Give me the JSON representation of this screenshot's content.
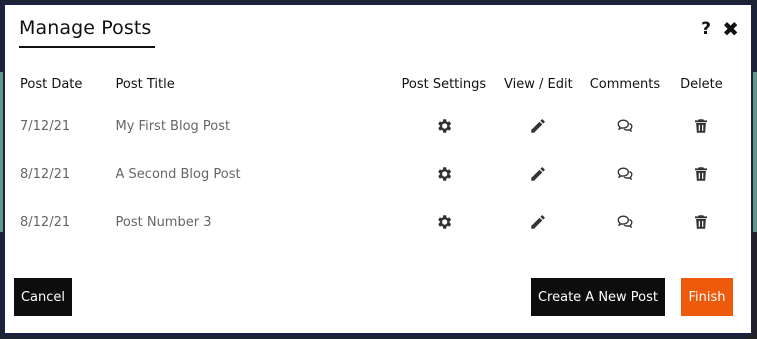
{
  "modal": {
    "title": "Manage Posts",
    "help_glyph": "?",
    "close_glyph": "✖"
  },
  "table": {
    "headers": {
      "date": "Post Date",
      "title": "Post Title",
      "settings": "Post Settings",
      "view": "View / Edit",
      "comments": "Comments",
      "delete": "Delete"
    },
    "rows": [
      {
        "date": "7/12/21",
        "title": "My First Blog Post"
      },
      {
        "date": "8/12/21",
        "title": "A Second Blog Post"
      },
      {
        "date": "8/12/21",
        "title": "Post Number 3"
      }
    ],
    "icons": [
      "gear-icon",
      "pencil-icon",
      "comments-icon",
      "trash-icon"
    ]
  },
  "footer": {
    "cancel_label": "Cancel",
    "create_label": "Create A New Post",
    "finish_label": "Finish"
  },
  "colors": {
    "modal_border": "#1b1f4a",
    "button_dark": "#0d0d0d",
    "button_accent": "#ee5a0c",
    "icon": "#333333",
    "cell_text": "#666666",
    "backdrop_teal": "#5f9a86"
  }
}
